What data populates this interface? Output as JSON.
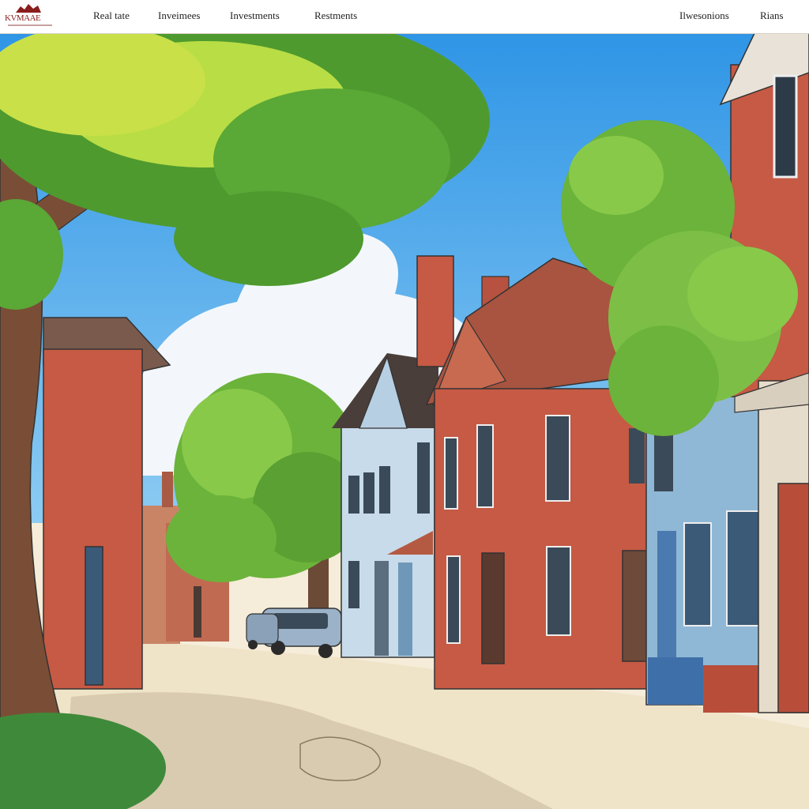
{
  "header": {
    "logo_text": "KVMAAE",
    "nav_left": [
      "Real tate",
      "Inveimees",
      "Investments",
      "Restments"
    ],
    "nav_right": [
      "Ilwesonions",
      "Rians"
    ]
  },
  "colors": {
    "brand": "#8a1d1d",
    "sky": "#4aa8e8",
    "brick": "#c65a44",
    "blue_building": "#8fb8d6",
    "foliage": "#6bb33a",
    "road": "#efe3c8"
  },
  "icons": [
    "logo-mark-icon"
  ]
}
